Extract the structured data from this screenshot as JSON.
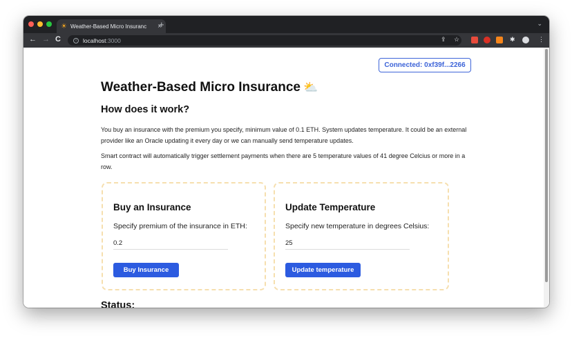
{
  "browser": {
    "tab_title": "Weather-Based Micro Insuranc",
    "tab_favicon": "☀",
    "tab_close": "×",
    "new_tab": "+",
    "tab_search": "⌄",
    "url_host": "localhost",
    "url_port": ":3000",
    "nav": {
      "back": "←",
      "forward": "→",
      "reload": "C"
    },
    "toolbar_icons": {
      "share": "⇪",
      "star": "☆",
      "puzzle": "✱",
      "menu": "⋮"
    },
    "extensions_colors": [
      "#e84b3c",
      "#d93025",
      "#f6851b"
    ],
    "avatar_color": "#dadce0"
  },
  "page": {
    "connected_label": "Connected: 0xf39f...2266",
    "title": "Weather-Based Micro Insurance",
    "title_icon": "⛅",
    "how_heading": "How does it work?",
    "para1": "You buy an insurance with the premium you specify, minimum value of 0.1 ETH. System updates temperature. It could be an external provider like an Oracle updating it every day or we can manually send temperature updates.",
    "para2": "Smart contract will automatically trigger settlement payments when there are 5 temperature values of 41 degree Celcius or more in a row.",
    "buy_card": {
      "title": "Buy an Insurance",
      "label": "Specify premium of the insurance in ETH:",
      "value": "0.2",
      "button": "Buy Insurance"
    },
    "temp_card": {
      "title": "Update Temperature",
      "label": "Specify new temperature in degrees Celsius:",
      "value": "25",
      "button": "Update temperature"
    },
    "status_heading": "Status:"
  },
  "colors": {
    "accent": "#2c5be0",
    "connected_border": "#3c63d8",
    "card_border": "#f6dfae"
  }
}
